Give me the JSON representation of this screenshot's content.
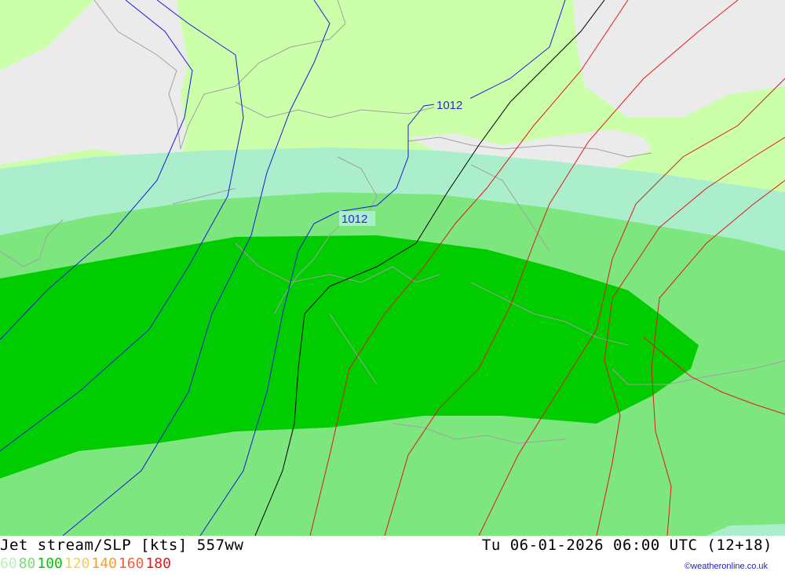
{
  "title": "Jet stream/SLP [kts] 557ww",
  "datetime": "Tu 06-01-2026 06:00 UTC (12+18)",
  "credit": "©weatheronline.co.uk",
  "legend": [
    {
      "label": "60",
      "color": "#b8f0b8"
    },
    {
      "label": "80",
      "color": "#78dc78"
    },
    {
      "label": "100",
      "color": "#00c800"
    },
    {
      "label": "120",
      "color": "#f0d060"
    },
    {
      "label": "140",
      "color": "#f0a030"
    },
    {
      "label": "160",
      "color": "#f06040"
    },
    {
      "label": "180",
      "color": "#e01818"
    }
  ],
  "isobar_labels": [
    "1012",
    "1012"
  ],
  "colors": {
    "land": "#ccffaa",
    "sea": "#ebebeb",
    "jet_60": "#aaeecc",
    "jet_80": "#78e678",
    "jet_100": "#00cc00",
    "isobar_low": "#1a1ad8",
    "isobar_1016": "#000000",
    "isobar_high": "#e01818",
    "coastline": "#a0a0a0"
  }
}
